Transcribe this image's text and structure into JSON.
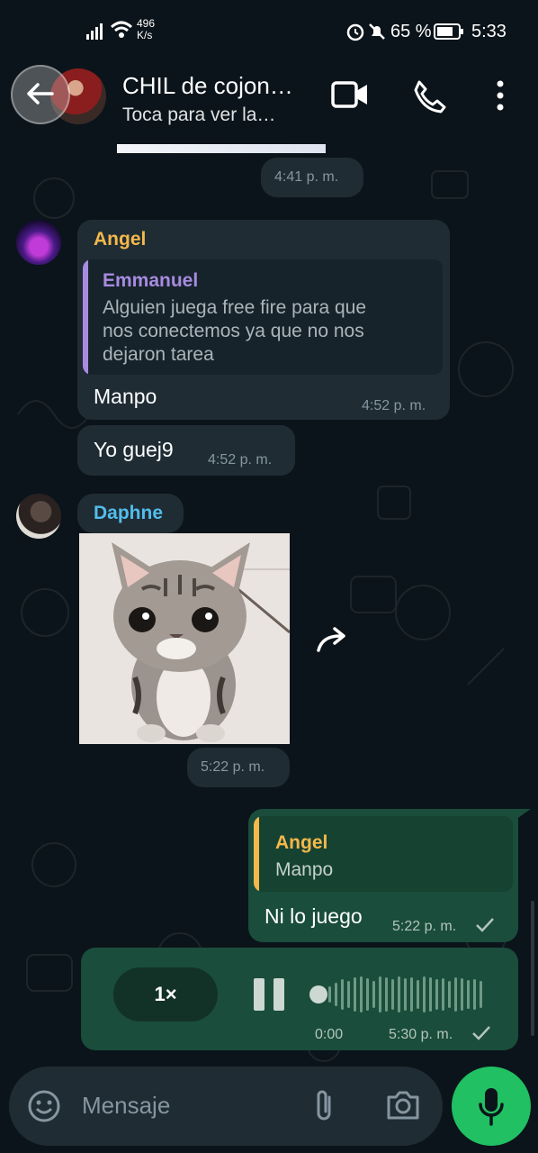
{
  "status_bar": {
    "net_speed_value": "496",
    "net_speed_unit": "K/s",
    "battery_percent": "65 %",
    "time": "5:33"
  },
  "header": {
    "title": "CHIL de cojon…",
    "subtitle": "Toca para ver la…"
  },
  "messages": {
    "m1_time": "4:41 p. m.",
    "m2_sender": "Angel",
    "m2_quote_sender": "Emmanuel",
    "m2_quote_line1": "Alguien juega free fire para que",
    "m2_quote_line2": "nos conectemos ya que no nos",
    "m2_quote_line3": "dejaron tarea",
    "m2_text": "Manpo",
    "m2_time": "4:52 p. m.",
    "m3_text": "Yo guej9",
    "m3_time": "4:52 p. m.",
    "m4_sender": "Daphne",
    "m4_time": "5:22 p. m.",
    "m5_quote_sender": "Angel",
    "m5_quote_text": "Manpo",
    "m5_text": "Ni lo juego",
    "m5_time": "5:22 p. m.",
    "voice_speed": "1×",
    "voice_elapsed": "0:00",
    "voice_time": "5:30 p. m.",
    "voice_progress": 0.0
  },
  "composer": {
    "placeholder": "Mensaje"
  },
  "colors": {
    "accent_green": "#21c063",
    "angel_name": "#f5b84a",
    "daphne_name": "#53bdeb",
    "emmanuel_name": "#a78be0"
  },
  "icons": [
    "back-arrow-icon",
    "video-call-icon",
    "phone-icon",
    "more-options-icon",
    "forward-icon",
    "pause-icon",
    "emoji-icon",
    "attach-icon",
    "camera-icon",
    "mic-icon",
    "read-check-icon"
  ]
}
